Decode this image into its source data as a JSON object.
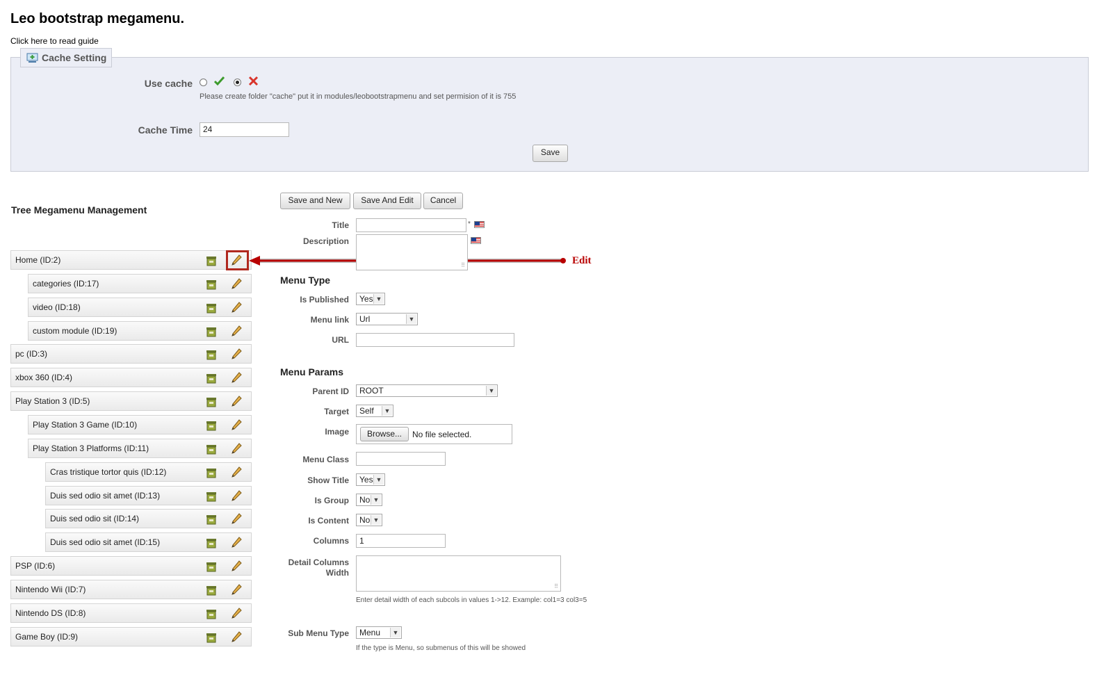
{
  "page": {
    "title": "Leo bootstrap megamenu.",
    "guide_link": "Click here to read guide"
  },
  "cache": {
    "legend": "Cache Setting",
    "use_cache_label": "Use cache",
    "use_cache_selected": "no",
    "hint": "Please create folder \"cache\" put it in modules/leobootstrapmenu and set permision of it is 755",
    "time_label": "Cache Time",
    "time_value": "24",
    "save_label": "Save"
  },
  "tree": {
    "heading": "Tree Megamenu Management",
    "items": [
      {
        "label": "Home (ID:2)",
        "level": 0
      },
      {
        "label": "categories (ID:17)",
        "level": 1
      },
      {
        "label": "video (ID:18)",
        "level": 1
      },
      {
        "label": "custom module (ID:19)",
        "level": 1
      },
      {
        "label": "pc (ID:3)",
        "level": 0
      },
      {
        "label": "xbox 360 (ID:4)",
        "level": 0
      },
      {
        "label": "Play Station 3 (ID:5)",
        "level": 0
      },
      {
        "label": "Play Station 3 Game (ID:10)",
        "level": 1
      },
      {
        "label": "Play Station 3 Platforms (ID:11)",
        "level": 1
      },
      {
        "label": "Cras tristique tortor quis (ID:12)",
        "level": 2
      },
      {
        "label": "Duis sed odio sit amet (ID:13)",
        "level": 2
      },
      {
        "label": "Duis sed odio sit (ID:14)",
        "level": 2
      },
      {
        "label": "Duis sed odio sit amet (ID:15)",
        "level": 2
      },
      {
        "label": "PSP (ID:6)",
        "level": 0
      },
      {
        "label": "Nintendo Wii (ID:7)",
        "level": 0
      },
      {
        "label": "Nintendo DS (ID:8)",
        "level": 0
      },
      {
        "label": "Game Boy (ID:9)",
        "level": 0
      }
    ]
  },
  "annotation": {
    "label": "Edit",
    "color": "#b80000"
  },
  "form": {
    "buttons": {
      "save_new": "Save and New",
      "save_edit": "Save And Edit",
      "cancel": "Cancel"
    },
    "title_label": "Title",
    "title_value": "",
    "required_mark": "*",
    "description_label": "Description",
    "menu_type_heading": "Menu Type",
    "is_published_label": "Is Published",
    "is_published_value": "Yes",
    "menu_link_label": "Menu link",
    "menu_link_value": "Url",
    "url_label": "URL",
    "url_value": "",
    "menu_params_heading": "Menu Params",
    "parent_id_label": "Parent ID",
    "parent_id_value": "ROOT",
    "target_label": "Target",
    "target_value": "Self",
    "image_label": "Image",
    "browse_label": "Browse...",
    "no_file_label": "No file selected.",
    "menu_class_label": "Menu Class",
    "menu_class_value": "",
    "show_title_label": "Show Title",
    "show_title_value": "Yes",
    "is_group_label": "Is Group",
    "is_group_value": "No",
    "is_content_label": "Is Content",
    "is_content_value": "No",
    "columns_label": "Columns",
    "columns_value": "1",
    "detail_columns_label_1": "Detail Columns",
    "detail_columns_label_2": "Width",
    "detail_hint": "Enter detail width of each subcols in values 1->12. Example: col1=3 col3=5",
    "sub_menu_type_label": "Sub Menu Type",
    "sub_menu_type_value": "Menu",
    "sub_menu_hint": "If the type is Menu, so submenus of this will be showed"
  }
}
